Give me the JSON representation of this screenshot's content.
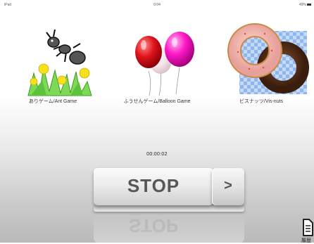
{
  "status": {
    "device": "iPad",
    "time": "0:04",
    "battery": "49%"
  },
  "games": [
    {
      "label": "ありゲーム/Ant Game",
      "icon": "ant-icon"
    },
    {
      "label": "ふうせんゲーム/Balloon Game",
      "icon": "balloon-icon"
    },
    {
      "label": "ビスナッツ/Vis-nuts",
      "icon": "donut-icon"
    }
  ],
  "timer": "00:00:02",
  "controls": {
    "stop_label": "STOP",
    "next_label": ">"
  },
  "history": {
    "label": "履歴",
    "icon": "document-icon"
  }
}
